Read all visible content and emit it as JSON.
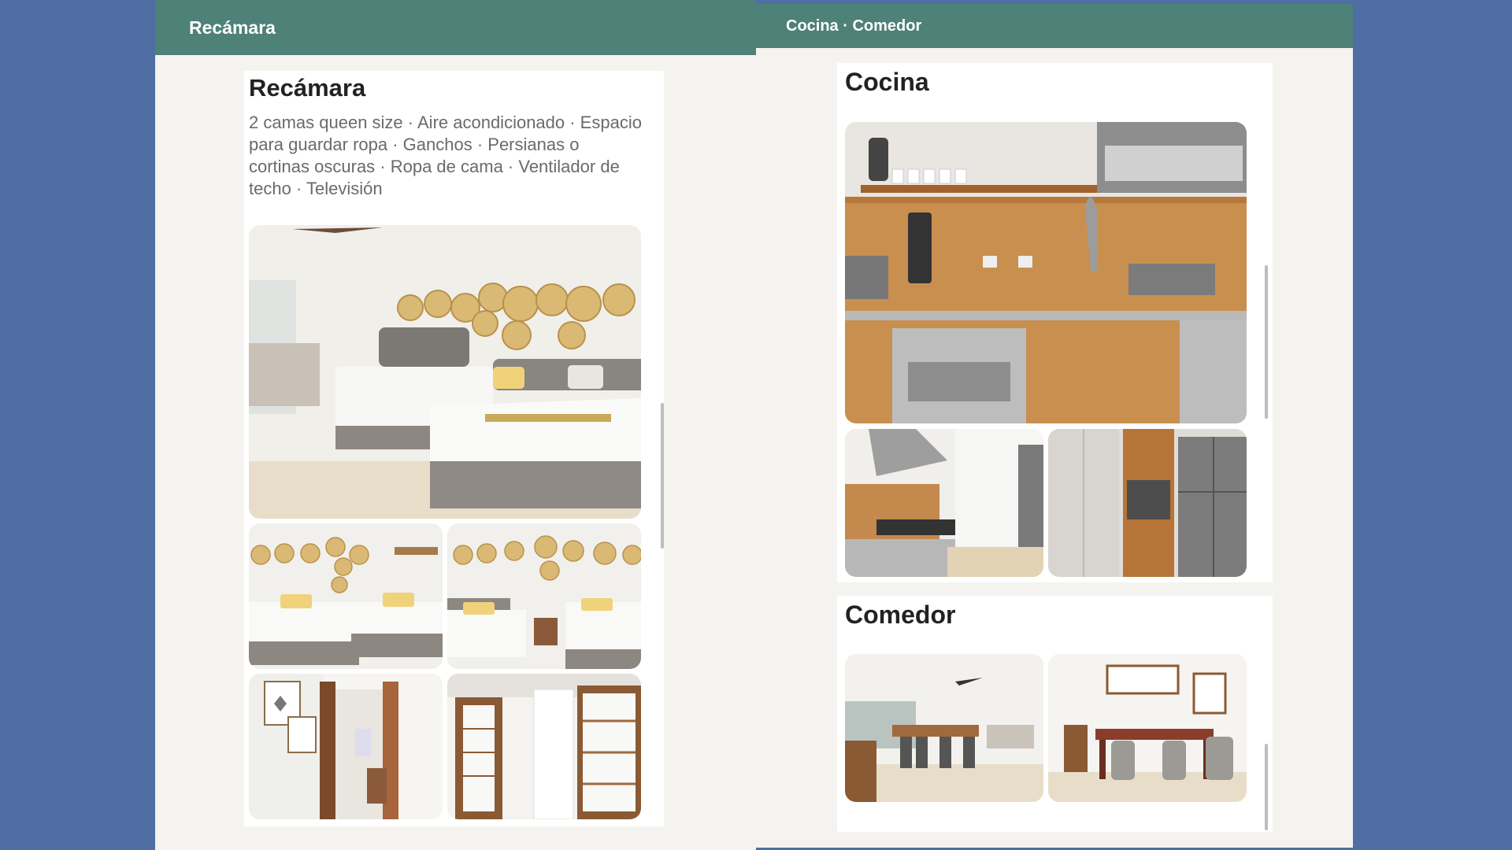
{
  "windows": {
    "bedroom": {
      "title": "Recámara",
      "section": {
        "heading": "Recámara",
        "amenities": "2 camas queen size · Aire acondicionado · Espacio para guardar ropa · Ganchos · Persianas o cortinas oscuras · Ropa de cama · Ventilador de techo · Televisión"
      }
    },
    "kitchen_dining": {
      "title": "Cocina · Comedor",
      "sections": {
        "kitchen": {
          "heading": "Cocina"
        },
        "dining": {
          "heading": "Comedor"
        }
      }
    }
  },
  "colors": {
    "desktop": "#4f6ea3",
    "titlebar": "#4e8177",
    "window_bg": "#f4f3ef",
    "card_bg": "#ffffff",
    "heading": "#222222",
    "body_text": "#6a6a6a"
  }
}
